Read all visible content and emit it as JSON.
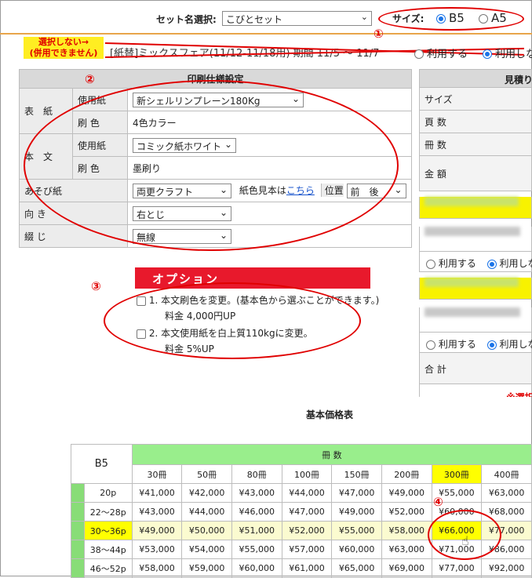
{
  "top": {
    "set_label": "セット名選択:",
    "set_value": "こびとセット",
    "size_label": "サイズ:",
    "size_b5": "B5",
    "size_a5": "A5"
  },
  "campaign": {
    "note_line1": "選択しない→",
    "note_line2": "(併用できません)",
    "text": "[紙替]ミックスフェア(11/12-11/18用) 期間 11/5 〜 11/7",
    "use": "利用する",
    "nouse": "利用しない"
  },
  "spec": {
    "header": "印刷仕様設定",
    "cover": "表　紙",
    "body": "本　文",
    "paper": "使用紙",
    "print_color": "刷 色",
    "cover_paper": "新シェルリンプレーン180Kg",
    "cover_color": "4色カラー",
    "body_paper": "コミック紙ホワイト",
    "body_color": "墨刷り",
    "asobi": "あそび紙",
    "asobi_value": "両更クラフト",
    "sample_text": "紙色見本は",
    "sample_link": "こちら",
    "position_label": "位置",
    "position_value": "前　後",
    "direction": "向 き",
    "direction_value": "右とじ",
    "binding": "綴 じ",
    "binding_value": "無線"
  },
  "quote": {
    "header": "見積り",
    "rows": [
      "サイズ",
      "頁 数",
      "冊 数",
      "金 額"
    ],
    "use": "利用する",
    "nouse": "利用しない",
    "total": "合 計",
    "note": "※選択"
  },
  "options": {
    "title": "オプション",
    "opt1": "1. 本文刷色を変更。(基本色から選ぶことができます。)",
    "opt1_price": "料金 4,000円UP",
    "opt2": "2. 本文使用紙を白上質110kgに変更。",
    "opt2_price": "料金 5%UP"
  },
  "price_table": {
    "title": "基本価格表",
    "size": "B5",
    "qty_header": "冊 数",
    "columns": [
      "30冊",
      "50冊",
      "80冊",
      "100冊",
      "150冊",
      "200冊",
      "300冊",
      "400冊"
    ],
    "rows": [
      {
        "label": "20p",
        "values": [
          "¥41,000",
          "¥42,000",
          "¥43,000",
          "¥44,000",
          "¥47,000",
          "¥49,000",
          "¥55,000",
          "¥63,000"
        ]
      },
      {
        "label": "22〜28p",
        "values": [
          "¥43,000",
          "¥44,000",
          "¥46,000",
          "¥47,000",
          "¥49,000",
          "¥52,000",
          "¥60,000",
          "¥68,000"
        ]
      },
      {
        "label": "30〜36p",
        "values": [
          "¥49,000",
          "¥50,000",
          "¥51,000",
          "¥52,000",
          "¥55,000",
          "¥58,000",
          "¥66,000",
          "¥77,000"
        ]
      },
      {
        "label": "38〜44p",
        "values": [
          "¥53,000",
          "¥54,000",
          "¥55,000",
          "¥57,000",
          "¥60,000",
          "¥63,000",
          "¥71,000",
          "¥86,000"
        ]
      },
      {
        "label": "46〜52p",
        "values": [
          "¥58,000",
          "¥59,000",
          "¥60,000",
          "¥61,000",
          "¥65,000",
          "¥69,000",
          "¥77,000",
          "¥92,000"
        ]
      }
    ]
  },
  "annotations": {
    "n1": "①",
    "n2": "②",
    "n3": "③",
    "n4": "④"
  },
  "colors": {
    "accent_red": "#e00000",
    "option_red": "#e8192c",
    "header_green": "#99ee8c",
    "highlight_yellow": "#ffff00"
  }
}
